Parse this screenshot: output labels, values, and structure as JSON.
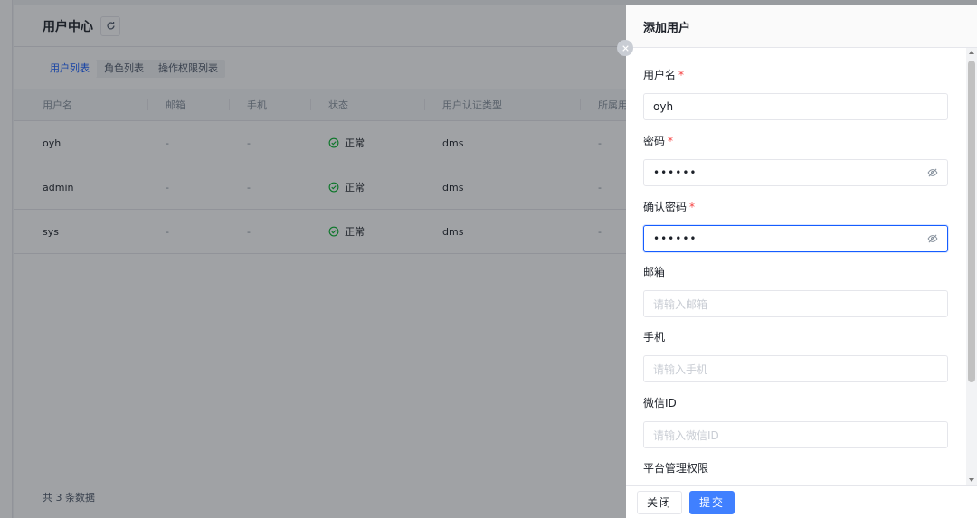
{
  "header": {
    "title": "用户中心"
  },
  "tabs": [
    {
      "label": "用户列表",
      "active": true
    },
    {
      "label": "角色列表",
      "active": false
    },
    {
      "label": "操作权限列表",
      "active": false
    }
  ],
  "table": {
    "columns": [
      "用户名",
      "邮箱",
      "手机",
      "状态",
      "用户认证类型",
      "所属用户"
    ],
    "rows": [
      {
        "username": "oyh",
        "email": "-",
        "phone": "-",
        "status": "正常",
        "auth_type": "dms",
        "group": "-"
      },
      {
        "username": "admin",
        "email": "-",
        "phone": "-",
        "status": "正常",
        "auth_type": "dms",
        "group": "-"
      },
      {
        "username": "sys",
        "email": "-",
        "phone": "-",
        "status": "正常",
        "auth_type": "dms",
        "group": "-"
      }
    ],
    "footer": "共 3 条数据"
  },
  "drawer": {
    "title": "添加用户",
    "fields": {
      "username": {
        "label": "用户名",
        "required": "*",
        "value": "oyh"
      },
      "password": {
        "label": "密码",
        "required": "*",
        "value": "••••••"
      },
      "confirm_password": {
        "label": "确认密码",
        "required": "*",
        "value": "••••••"
      },
      "email": {
        "label": "邮箱",
        "placeholder": "请输入邮箱"
      },
      "phone": {
        "label": "手机",
        "placeholder": "请输入手机"
      },
      "wechat": {
        "label": "微信ID",
        "placeholder": "请输入微信ID"
      },
      "platform": {
        "label": "平台管理权限"
      }
    },
    "buttons": {
      "close": "关闭",
      "submit": "提交"
    }
  },
  "colors": {
    "primary": "#165dff",
    "success": "#00b42a",
    "required": "#f53f3f",
    "mask": "rgba(29,33,41,0.42)"
  },
  "icons": {
    "refresh": "refresh-icon",
    "status": "check-circle-icon",
    "eye": "eye-invisible-icon",
    "close": "close-icon"
  }
}
